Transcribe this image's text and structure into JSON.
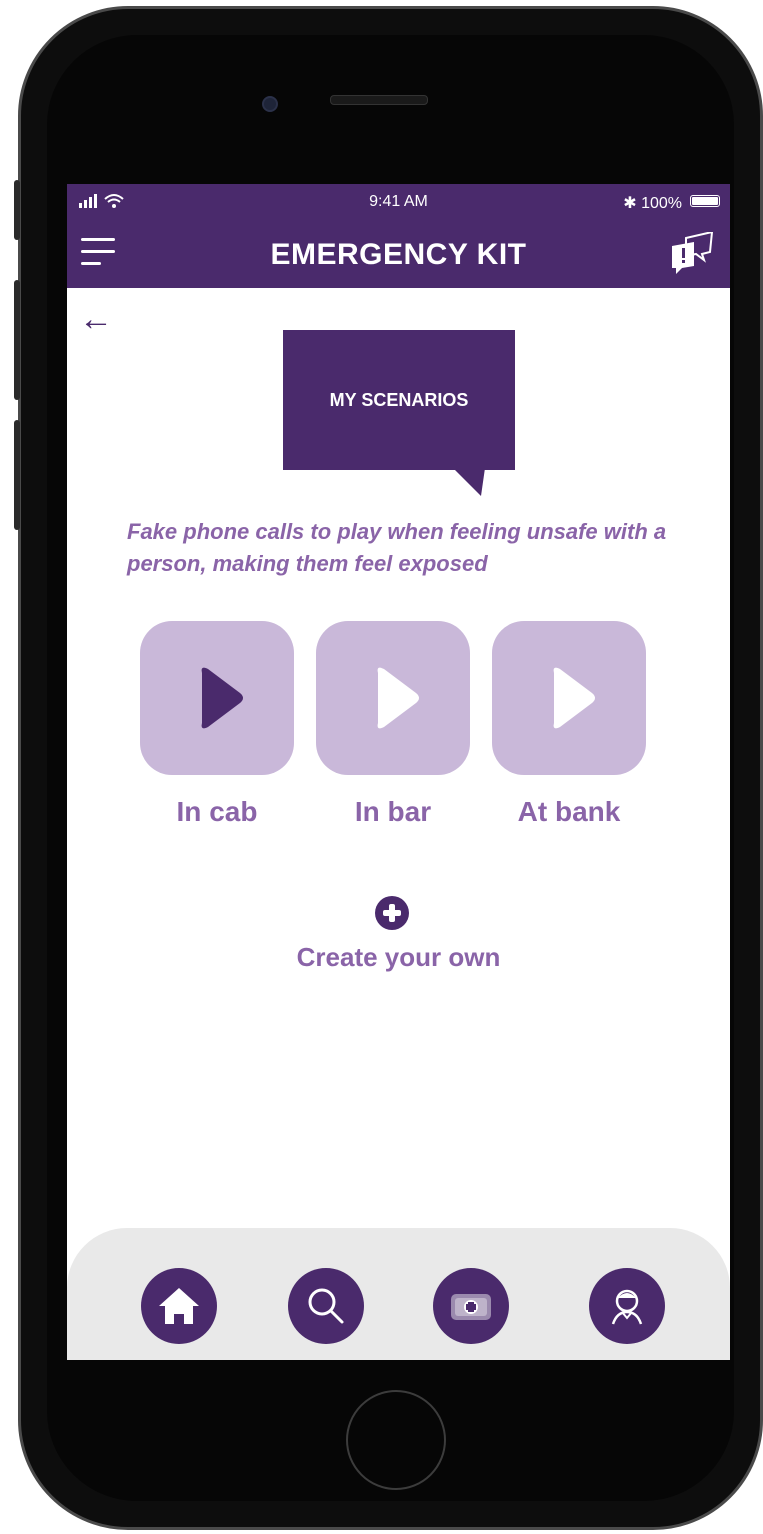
{
  "status_bar": {
    "time": "9:41 AM",
    "battery": "100%"
  },
  "header": {
    "title": "EMERGENCY KIT"
  },
  "scenario_bubble": {
    "label": "MY SCENARIOS"
  },
  "description": "Fake phone calls to play when feeling unsafe with a person, making them feel exposed",
  "scenarios": [
    {
      "label": "In cab",
      "selected": true
    },
    {
      "label": "In bar",
      "selected": false
    },
    {
      "label": "At bank",
      "selected": false
    }
  ],
  "create_own": {
    "label": "Create your own"
  },
  "tab_bar": {
    "icons": [
      "home-icon",
      "search-icon",
      "first-aid-kit-icon",
      "profile-icon"
    ]
  },
  "colors": {
    "primary": "#4a2a6c",
    "accent_text": "#8a64a8",
    "tile_bg": "#c9b8d9",
    "tab_bar_bg": "#e9e9e9"
  }
}
